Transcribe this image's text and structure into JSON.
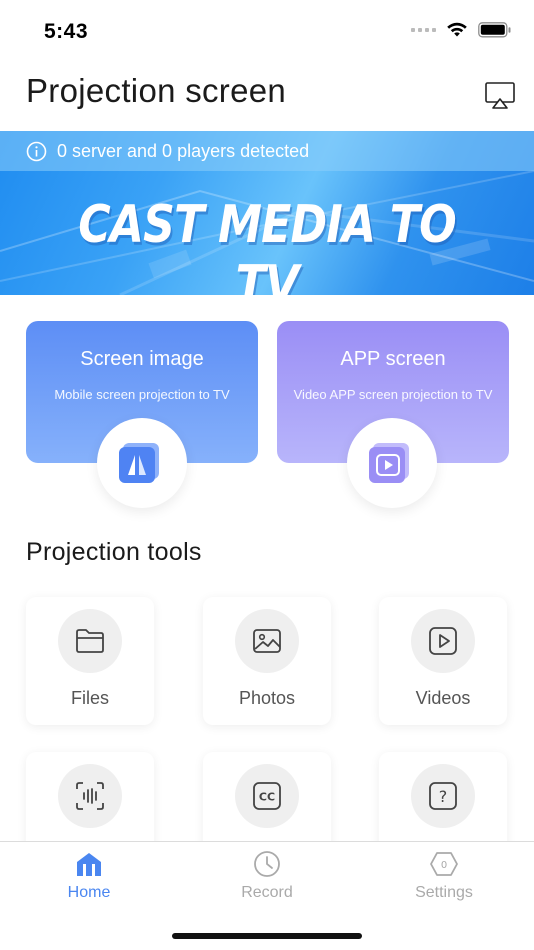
{
  "status": {
    "time": "5:43"
  },
  "header": {
    "title": "Projection screen",
    "airplay_icon": "airplay-icon"
  },
  "banner": {
    "info_text": "0 server and 0 players detected",
    "headline": "CAST MEDIA TO TV"
  },
  "cards": [
    {
      "title": "Screen image",
      "subtitle": "Mobile screen projection to TV",
      "icon": "mirror-icon",
      "color": "#5d8ef5"
    },
    {
      "title": "APP screen",
      "subtitle": "Video APP screen projection to TV",
      "icon": "app-video-icon",
      "color": "#9a8ef5"
    }
  ],
  "tools": {
    "title": "Projection tools",
    "items": [
      {
        "label": "Files",
        "icon": "folder-icon"
      },
      {
        "label": "Photos",
        "icon": "photo-icon"
      },
      {
        "label": "Videos",
        "icon": "video-play-icon"
      },
      {
        "label": "",
        "icon": "audio-wave-icon"
      },
      {
        "label": "",
        "icon": "captions-icon"
      },
      {
        "label": "",
        "icon": "help-icon"
      }
    ]
  },
  "tabbar": {
    "items": [
      {
        "label": "Home",
        "icon": "home-icon",
        "active": true
      },
      {
        "label": "Record",
        "icon": "clock-icon",
        "active": false
      },
      {
        "label": "Settings",
        "icon": "hexagon-icon",
        "active": false
      }
    ],
    "active_color": "#4a86f0",
    "inactive_color": "#aaaaaa"
  }
}
